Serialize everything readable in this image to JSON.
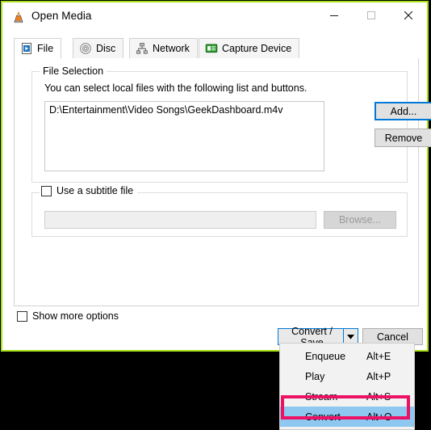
{
  "window": {
    "title": "Open Media",
    "app_icon": "vlc-cone-icon",
    "controls": {
      "minimize": "minimize-icon",
      "maximize": "maximize-icon",
      "close": "close-icon"
    },
    "border_color": "#a6e015"
  },
  "tabs": [
    {
      "label": "File",
      "icon": "file-play-icon",
      "active": true
    },
    {
      "label": "Disc",
      "icon": "disc-icon",
      "active": false
    },
    {
      "label": "Network",
      "icon": "network-icon",
      "active": false
    },
    {
      "label": "Capture Device",
      "icon": "capture-device-icon",
      "active": false
    }
  ],
  "file_selection": {
    "group_title": "File Selection",
    "hint": "You can select local files with the following list and buttons.",
    "files": [
      "D:\\Entertainment\\Video Songs\\GeekDashboard.m4v"
    ],
    "add_label": "Add...",
    "remove_label": "Remove"
  },
  "subtitle": {
    "checkbox_label": "Use a subtitle file",
    "checked": false,
    "path_value": "",
    "path_placeholder": "",
    "browse_label": "Browse...",
    "browse_enabled": false
  },
  "bottom": {
    "show_more_label": "Show more options",
    "show_more_checked": false,
    "convert_save_label": "Convert / Save",
    "dropdown_arrow": "chevron-down-icon",
    "cancel_label": "Cancel"
  },
  "dropdown_menu": {
    "open": true,
    "items": [
      {
        "label": "Enqueue",
        "accel": "Alt+E",
        "selected": false
      },
      {
        "label": "Play",
        "accel": "Alt+P",
        "selected": false
      },
      {
        "label": "Stream",
        "accel": "Alt+S",
        "selected": false
      },
      {
        "label": "Convert",
        "accel": "Alt+O",
        "selected": true
      }
    ],
    "highlight_color": "#8ec7f0"
  },
  "annotation": {
    "target": "Convert",
    "color": "#ec1164"
  }
}
